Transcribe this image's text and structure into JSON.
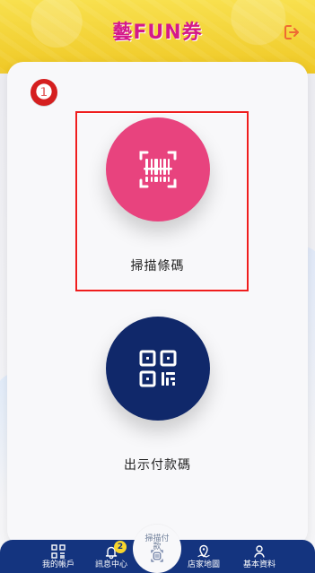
{
  "app": {
    "logo_text": "藝FUN券"
  },
  "main": {
    "marker": "❶",
    "scan_label": "掃描條碼",
    "payment_code_label": "出示付款碼"
  },
  "bottom_nav": {
    "center_label": "掃描付款",
    "items": [
      {
        "label": "我的帳戶"
      },
      {
        "label": "訊息中心",
        "badge": "2"
      },
      {
        "label": "店家地圖"
      },
      {
        "label": "基本資料"
      }
    ]
  },
  "icons": {
    "exit": "logout-icon",
    "scan": "barcode-scan-icon",
    "payment_code": "qr-code-icon",
    "account": "account-grid-icon",
    "message": "bell-icon",
    "center": "scan-pay-icon",
    "map": "map-icon",
    "profile": "user-icon"
  },
  "colors": {
    "header_yellow": "#f4d93d",
    "scan_pink": "#e8437e",
    "code_navy": "#10286a",
    "nav_blue": "#14347f",
    "marker_red": "#d51f1f",
    "highlight_red": "#ef1d1d"
  }
}
